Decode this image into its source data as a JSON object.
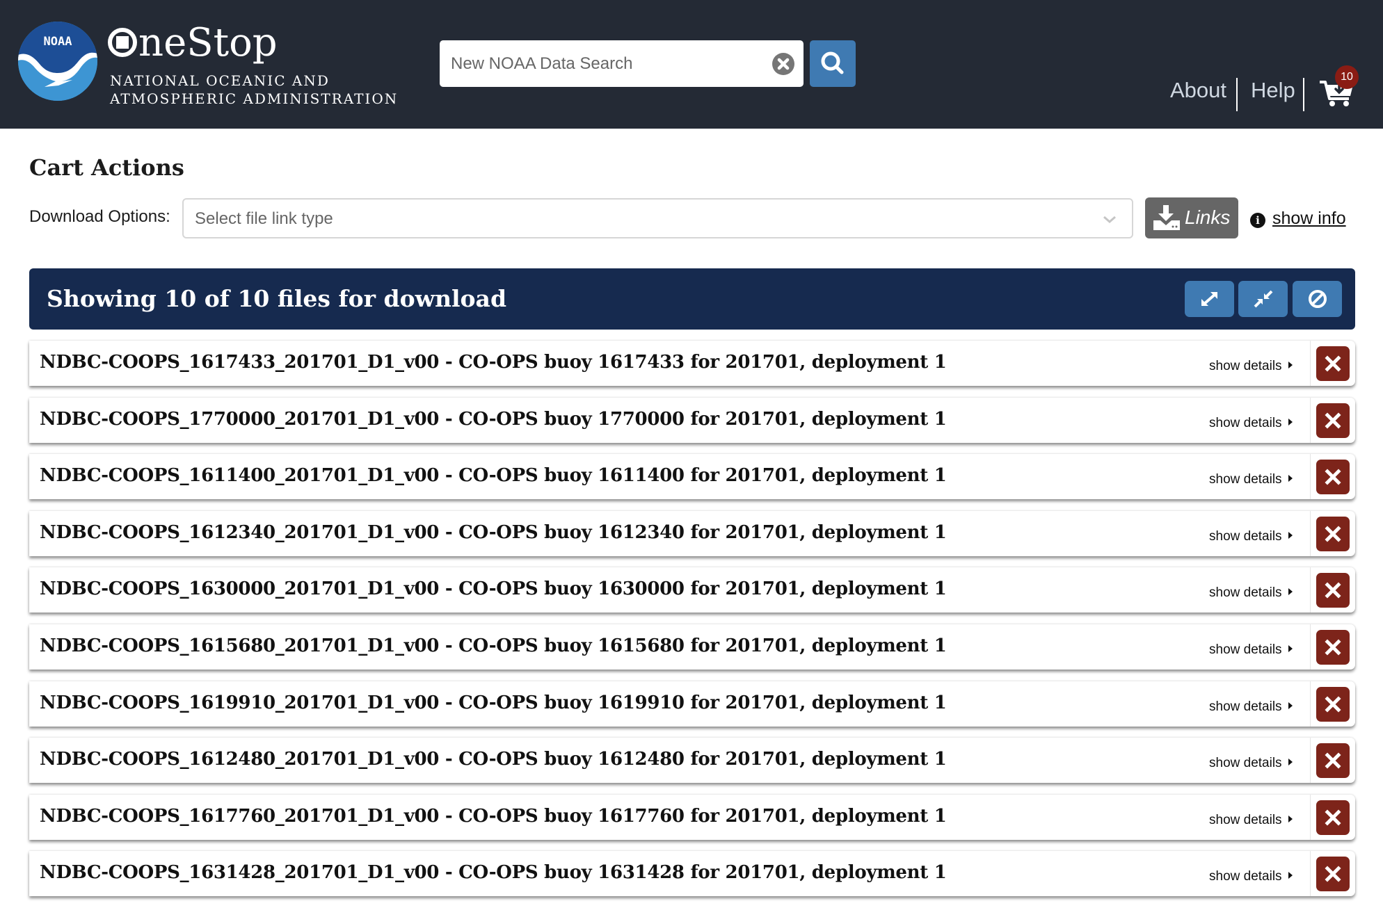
{
  "header": {
    "brand": "neStop",
    "agency_line1": "NATIONAL OCEANIC AND",
    "agency_line2": "ATMOSPHERIC ADMINISTRATION",
    "logo_text": "NOAA",
    "search": {
      "value": "",
      "placeholder": "New NOAA Data Search"
    },
    "nav": {
      "about": "About",
      "help": "Help"
    },
    "cart_count": "10"
  },
  "cart_actions": {
    "title": "Cart Actions",
    "download_label": "Download Options:",
    "select_placeholder": "Select file link type",
    "links_button": "Links",
    "show_info": "show info"
  },
  "files_header": {
    "title": "Showing 10 of 10 files for download",
    "buttons": [
      "expand-all",
      "collapse-all",
      "clear-all"
    ]
  },
  "colors": {
    "header_bg": "#242a35",
    "accent_blue": "#3f7ab2",
    "list_header_bg": "#162a4f",
    "remove_red": "#7d241a",
    "badge_red": "#8a1c14"
  },
  "files": [
    {
      "title": "NDBC-COOPS_1617433_201701_D1_v00 - CO-OPS buoy 1617433 for 201701, deployment 1",
      "details_label": "show details"
    },
    {
      "title": "NDBC-COOPS_1770000_201701_D1_v00 - CO-OPS buoy 1770000 for 201701, deployment 1",
      "details_label": "show details"
    },
    {
      "title": "NDBC-COOPS_1611400_201701_D1_v00 - CO-OPS buoy 1611400 for 201701, deployment 1",
      "details_label": "show details"
    },
    {
      "title": "NDBC-COOPS_1612340_201701_D1_v00 - CO-OPS buoy 1612340 for 201701, deployment 1",
      "details_label": "show details"
    },
    {
      "title": "NDBC-COOPS_1630000_201701_D1_v00 - CO-OPS buoy 1630000 for 201701, deployment 1",
      "details_label": "show details"
    },
    {
      "title": "NDBC-COOPS_1615680_201701_D1_v00 - CO-OPS buoy 1615680 for 201701, deployment 1",
      "details_label": "show details"
    },
    {
      "title": "NDBC-COOPS_1619910_201701_D1_v00 - CO-OPS buoy 1619910 for 201701, deployment 1",
      "details_label": "show details"
    },
    {
      "title": "NDBC-COOPS_1612480_201701_D1_v00 - CO-OPS buoy 1612480 for 201701, deployment 1",
      "details_label": "show details"
    },
    {
      "title": "NDBC-COOPS_1617760_201701_D1_v00 - CO-OPS buoy 1617760 for 201701, deployment 1",
      "details_label": "show details"
    },
    {
      "title": "NDBC-COOPS_1631428_201701_D1_v00 - CO-OPS buoy 1631428 for 201701, deployment 1",
      "details_label": "show details"
    }
  ]
}
